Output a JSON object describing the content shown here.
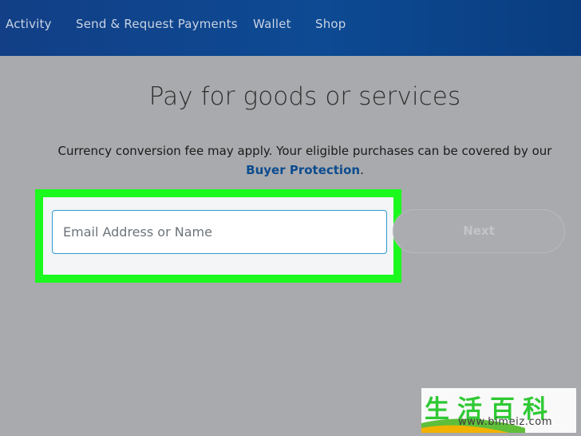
{
  "nav": {
    "items": [
      {
        "label": "Activity"
      },
      {
        "label": "Send & Request Payments"
      },
      {
        "label": "Wallet"
      },
      {
        "label": "Shop"
      }
    ]
  },
  "main": {
    "title": "Pay for goods or services",
    "notice_line1": "Currency conversion fee may apply. Your eligible purchases can be covered by our",
    "notice_link": "Buyer Protection",
    "notice_end": ".",
    "recipient_field": {
      "value": "",
      "placeholder": "Email Address or Name"
    },
    "next_label": "Next"
  },
  "watermark": {
    "chars": "生活百科",
    "url": "www.bimeiz.com"
  },
  "colors": {
    "nav_bg": "#0d4a93",
    "highlight": "#1cf91e",
    "link": "#0c4c8f",
    "page_overlay": "#a9aaad"
  }
}
